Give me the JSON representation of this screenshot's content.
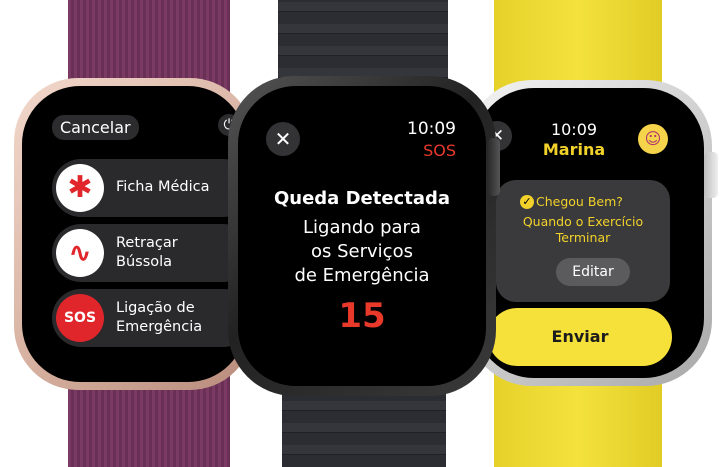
{
  "left_watch": {
    "cancel_label": "Cancelar",
    "power_icon": "power-icon",
    "rows": [
      {
        "icon": "asterisk-icon",
        "glyph": "✱",
        "label_line1": "Ficha Médica",
        "label_line2": ""
      },
      {
        "icon": "route-icon",
        "glyph": "∿",
        "label_line1": "Retraçar",
        "label_line2": "Bússola"
      },
      {
        "icon": "sos-icon",
        "glyph": "SOS",
        "label_line1": "Ligação de",
        "label_line2": "Emergência"
      }
    ]
  },
  "center_watch": {
    "time": "10:09",
    "status": "SOS",
    "title": "Queda Detectada",
    "message_line1": "Ligando para",
    "message_line2": "os Serviços",
    "message_line3": "de Emergência",
    "countdown": "15",
    "close_glyph": "✕"
  },
  "right_watch": {
    "close_glyph": "✕",
    "time": "10:09",
    "contact_name": "Marina",
    "card_title": "Chegou Bem?",
    "card_subtitle_line1": "Quando o Exercício",
    "card_subtitle_line2": "Terminar",
    "edit_label": "Editar",
    "send_label": "Enviar"
  },
  "colors": {
    "sos_red": "#e8392b",
    "accent_yellow": "#f2d22a"
  }
}
